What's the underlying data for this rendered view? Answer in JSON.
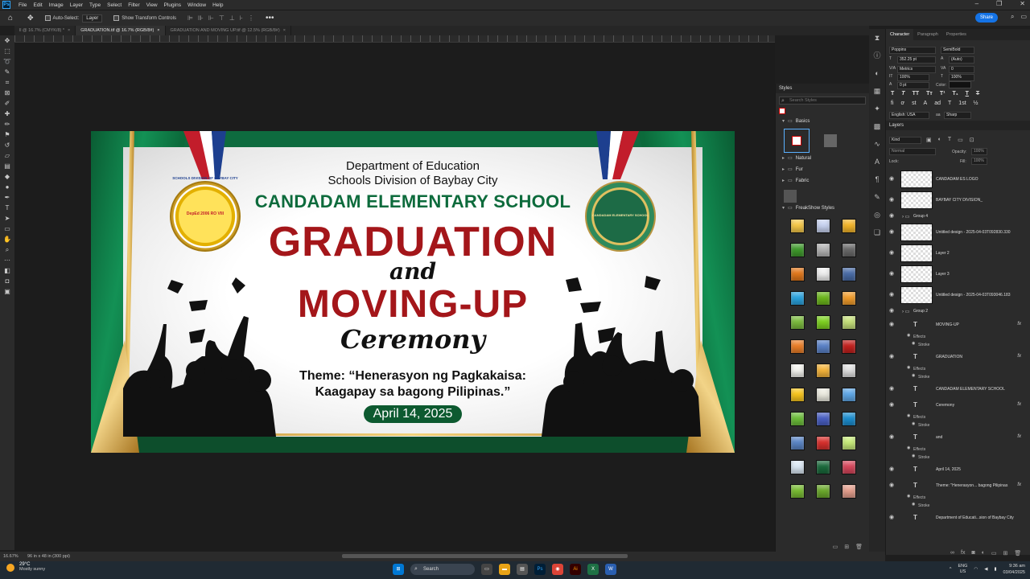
{
  "menubar": {
    "items": [
      "File",
      "Edit",
      "Image",
      "Layer",
      "Type",
      "Select",
      "Filter",
      "View",
      "Plugins",
      "Window",
      "Help"
    ]
  },
  "options": {
    "auto_select": "Auto-Select:",
    "auto_select_target": "Layer",
    "show_transform": "Show Transform Controls",
    "share": "Share"
  },
  "tabs": [
    {
      "label": "ll @ 16.7% (CMYK/8) *"
    },
    {
      "label": "GRADUATION.tif @ 16.7% (RGB/8#)"
    },
    {
      "label": "GRADUATION AND MOVING UP.tif @ 12.5% (RGB/8#)"
    }
  ],
  "artboard": {
    "dept": "Department of Education",
    "division": "Schools Division of Baybay City",
    "school": "CANDADAM ELEMENTARY SCHOOL",
    "graduation": "GRADUATION",
    "and": "and",
    "moving_up": "MOVING-UP",
    "ceremony": "Ceremony",
    "theme_line1": "Theme: “Henerasyon ng Pagkakaisa:",
    "theme_line2": "Kaagapay sa bagong Pilipinas.”",
    "date": "April 14, 2025",
    "seal_left_text": "SCHOOLS DIVISION OF BAYBAY CITY",
    "seal_left_sub": "DepEd 2006 RO VIII",
    "seal_right_text": "CANDADAM ELEMENTARY SCHOOL"
  },
  "styles_panel": {
    "title": "Styles",
    "search_placeholder": "Search Styles",
    "folders": [
      "Basics",
      "Natural",
      "Fur",
      "Fabric",
      "FreakShow Styles"
    ],
    "swatch_colors": [
      "#f7c948",
      "#c9d4f2",
      "#f5b629",
      "#3f9b2c",
      "#b4b4b4",
      "#6a6a6a",
      "#e3781b",
      "#f0f0f0",
      "#4a6da8",
      "#2aa4e0",
      "#6db81c",
      "#f29d2b",
      "#7cbc3e",
      "#7ed321",
      "#c6e17a",
      "#ec7f28",
      "#5b83c9",
      "#c4211e",
      "#f5f5f0",
      "#f6b53b",
      "#e2e2e2",
      "#f9c61c",
      "#ecebe0",
      "#5fa8e8",
      "#6dbf3a",
      "#4a60c4",
      "#1c8fd1",
      "#5b86c7",
      "#d9302d",
      "#c8ec7a",
      "#dce9f5",
      "#1a6b3c",
      "#d8475c",
      "#79bd32",
      "#6caa2c",
      "#e6a08e"
    ]
  },
  "char_panel": {
    "tabs": [
      "Character",
      "Paragraph",
      "Properties"
    ],
    "font": "Poppins",
    "weight": "SemiBold",
    "size": "352.25 pt",
    "leading": "(Auto)",
    "kerning": "Metrics",
    "tracking": "0",
    "vscale": "100%",
    "hscale": "100%",
    "baseline": "0 pt",
    "color_label": "Color:",
    "language": "English: USA",
    "aa": "Sharp"
  },
  "layers_panel": {
    "title": "Layers",
    "kind": "Kind",
    "blend": "Normal",
    "opacity_label": "Opacity:",
    "opacity": "100%",
    "lock_label": "Lock:",
    "fill_label": "Fill:",
    "fill": "100%",
    "layers": [
      {
        "name": "CANDADAM ES LOGO",
        "type": "image"
      },
      {
        "name": "BAYBAY CITY DIVISION_",
        "type": "image"
      },
      {
        "name": "Group 4",
        "type": "group"
      },
      {
        "name": "Untitled design - 2025-04-03T092830.330",
        "type": "image"
      },
      {
        "name": "Layer 2",
        "type": "image"
      },
      {
        "name": "Layer 3",
        "type": "image"
      },
      {
        "name": "Untitled design - 2025-04-03T093046.183",
        "type": "image"
      },
      {
        "name": "Group 2",
        "type": "group"
      },
      {
        "name": "MOVING-UP",
        "type": "text",
        "fx": true
      },
      {
        "name": "GRADUATION",
        "type": "text",
        "fx": true
      },
      {
        "name": "CANDADAM ELEMENTARY SCHOOL",
        "type": "text",
        "fx": false
      },
      {
        "name": "Ceremony",
        "type": "text",
        "fx": true
      },
      {
        "name": "and",
        "type": "text",
        "fx": true
      },
      {
        "name": "April 14, 2025",
        "type": "text",
        "fx": false
      },
      {
        "name": "Theme: \"Henerasyon... bagong Pilipinas",
        "type": "text",
        "fx": true
      },
      {
        "name": "Department of Educati...sion of Baybay City",
        "type": "text",
        "fx": false
      }
    ],
    "effects_label": "Effects",
    "stroke_label": "Stroke"
  },
  "status": {
    "zoom": "16.67%",
    "dims": "96 in x 48 in (300 ppi)"
  },
  "taskbar": {
    "temp": "29°C",
    "weather": "Mostly sunny",
    "search": "Search",
    "lang1": "ENG",
    "lang2": "US",
    "time": "9:36 am",
    "date": "03/04/2025"
  }
}
